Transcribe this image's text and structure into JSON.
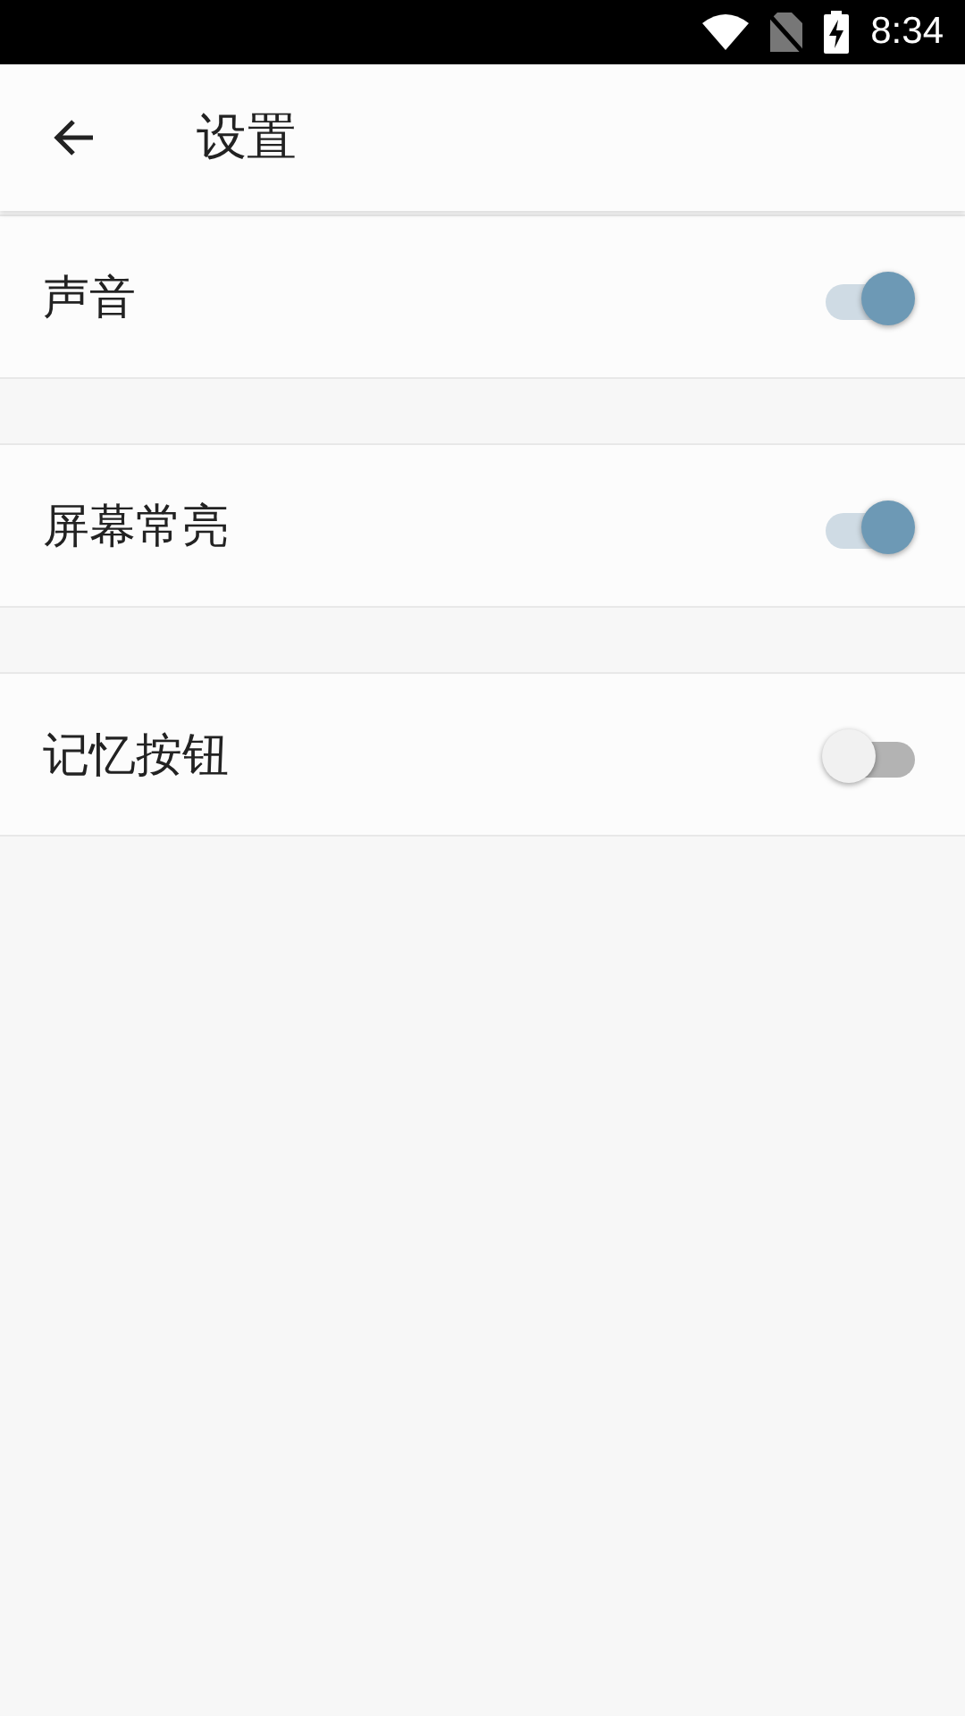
{
  "status_bar": {
    "time": "8:34"
  },
  "app_bar": {
    "title": "设置"
  },
  "settings": [
    {
      "label": "声音",
      "checked": true
    },
    {
      "label": "屏幕常亮",
      "checked": true
    },
    {
      "label": "记忆按钮",
      "checked": false
    }
  ]
}
